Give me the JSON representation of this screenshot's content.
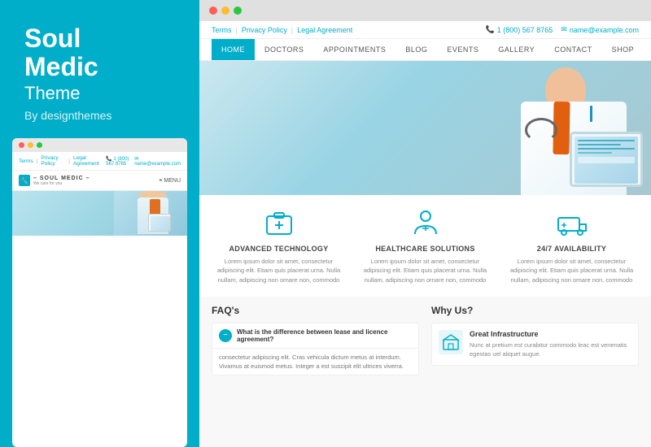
{
  "left": {
    "title_line1": "Soul",
    "title_line2": "Medic",
    "subtitle": "Theme",
    "by": "By designthemes"
  },
  "mini_browser": {
    "dots": [
      "red",
      "yellow",
      "green"
    ],
    "nav": {
      "links": [
        "Terms",
        "Privacy Policy",
        "Legal Agreement"
      ],
      "phone": "1 (800) 567 8765",
      "email": "name@example.com"
    },
    "logo": "– SOUL MEDIC –",
    "logo_sub": "We care for you",
    "menu": "≡  MENU"
  },
  "browser": {
    "dots": [
      "red",
      "yellow",
      "green"
    ]
  },
  "topbar": {
    "links": [
      "Terms",
      "Privacy Policy",
      "Legal Agreement"
    ],
    "phone": "1 (800) 567 8765",
    "email": "name@example.com"
  },
  "nav": {
    "items": [
      "HOME",
      "DOCTORS",
      "APPOINTMENTS",
      "BLOG",
      "EVENTS",
      "GALLERY",
      "CONTACT",
      "SHOP"
    ],
    "active": "HOME"
  },
  "features": [
    {
      "icon": "medical-bag",
      "title": "ADVANCED TECHNOLOGY",
      "text": "Lorem ipsum dolor sit amet, consectetur adipiscing elit. Etiam quis placerat urna. Nulla nullam, adipiscing non ornare non, commodo"
    },
    {
      "icon": "healthcare",
      "title": "HEALTHCARE SOLUTIONS",
      "text": "Lorem ipsum dolor sit amet, consectetur adipiscing elit. Etiam quis placerat urna. Nulla nullam, adipiscing non ornare non, commodo"
    },
    {
      "icon": "ambulance",
      "title": "24/7 AVAILABILITY",
      "text": "Lorem ipsum dolor sit amet, consectetur adipiscing elit. Etiam quis placerat urna. Nulla nullam, adipiscing non ornare non, commodo"
    }
  ],
  "faq": {
    "title": "FAQ's",
    "item": {
      "question": "What is the difference between lease and licence agreement?",
      "answer": "consectetur adipiscing elit. Cras vehicula dictum metus at interdum. Vivamus at euismod metus. Integer a est suscipit elit ultrices viverra."
    }
  },
  "why": {
    "title": "Why Us?",
    "item": {
      "title": "Great Infrastructure",
      "text": "Nunc at pretium est curabitur commodo leac est venenatis egestas uel aliquet augue."
    }
  }
}
